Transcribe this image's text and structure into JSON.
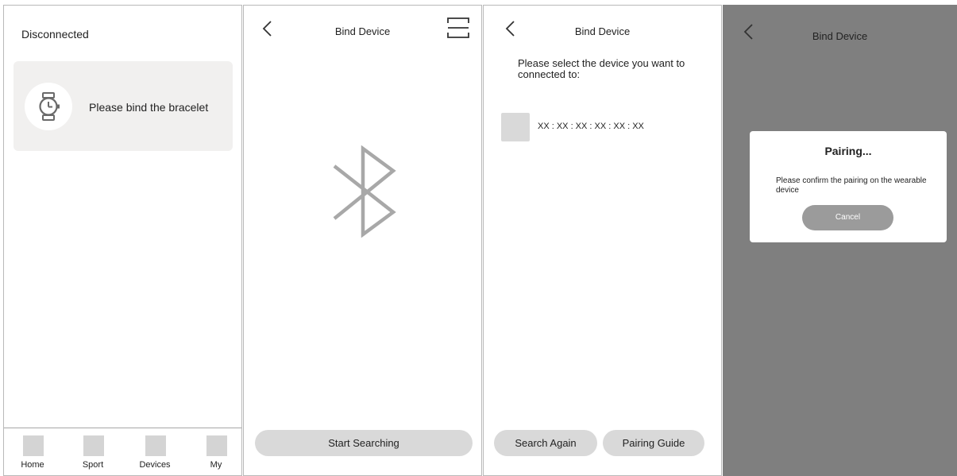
{
  "screen1": {
    "status": "Disconnected",
    "bind_prompt": "Please bind the bracelet",
    "card_icon": "watch-icon",
    "tabs": [
      {
        "label": "Home",
        "icon": "home-icon"
      },
      {
        "label": "Sport",
        "icon": "sport-icon"
      },
      {
        "label": "Devices",
        "icon": "devices-icon"
      },
      {
        "label": "My",
        "icon": "my-icon"
      }
    ]
  },
  "screen2": {
    "title": "Bind Device",
    "center_icon": "bluetooth-icon",
    "start_button": "Start Searching"
  },
  "screen3": {
    "title": "Bind Device",
    "prompt": "Please select the device you want to connected to:",
    "devices": [
      {
        "mac": "XX : XX : XX : XX : XX : XX"
      }
    ],
    "search_again_button": "Search Again",
    "pairing_guide_button": "Pairing Guide"
  },
  "screen4": {
    "title": "Bind Device",
    "dialog": {
      "title": "Pairing...",
      "message": "Please confirm the pairing on the wearable device",
      "cancel_button": "Cancel"
    }
  },
  "colors": {
    "card_bg": "#f1f0ef",
    "button_bg": "#d9d9d9",
    "overlay": "#7f7f7f",
    "dialog_button": "#9b9b9b",
    "icon_stroke": "#a8a8a8"
  }
}
